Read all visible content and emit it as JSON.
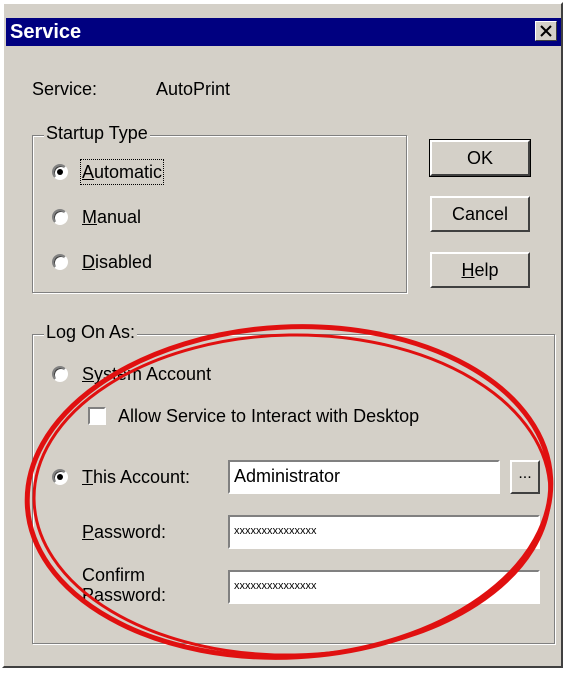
{
  "window": {
    "title": "Service"
  },
  "service": {
    "label": "Service:",
    "name": "AutoPrint"
  },
  "startup_type": {
    "legend": "Startup Type",
    "options": [
      {
        "label": "Automatic",
        "mnemonic": "A",
        "rest": "utomatic",
        "checked": true
      },
      {
        "label": "Manual",
        "mnemonic": "M",
        "rest": "anual",
        "checked": false
      },
      {
        "label": "Disabled",
        "mnemonic": "D",
        "rest": "isabled",
        "checked": false
      }
    ]
  },
  "buttons": {
    "ok": "OK",
    "cancel": "Cancel",
    "help_mnemonic": "H",
    "help_rest": "elp"
  },
  "log_on_as": {
    "legend": "Log On As:",
    "system_account": {
      "mnemonic": "S",
      "rest": "ystem Account",
      "checked": false
    },
    "interact_desktop": {
      "label": "Allow Service to Interact with Desktop",
      "checked": false
    },
    "this_account": {
      "mnemonic": "T",
      "rest": "his Account:",
      "checked": true,
      "value": "Administrator",
      "browse": "..."
    },
    "password": {
      "mnemonic": "P",
      "rest": "assword:",
      "value": "xxxxxxxxxxxxxxx"
    },
    "confirm_password": {
      "line1": "Confirm",
      "line2": "Password:",
      "value": "xxxxxxxxxxxxxxx"
    }
  },
  "annotation": {
    "color": "#e01010"
  }
}
